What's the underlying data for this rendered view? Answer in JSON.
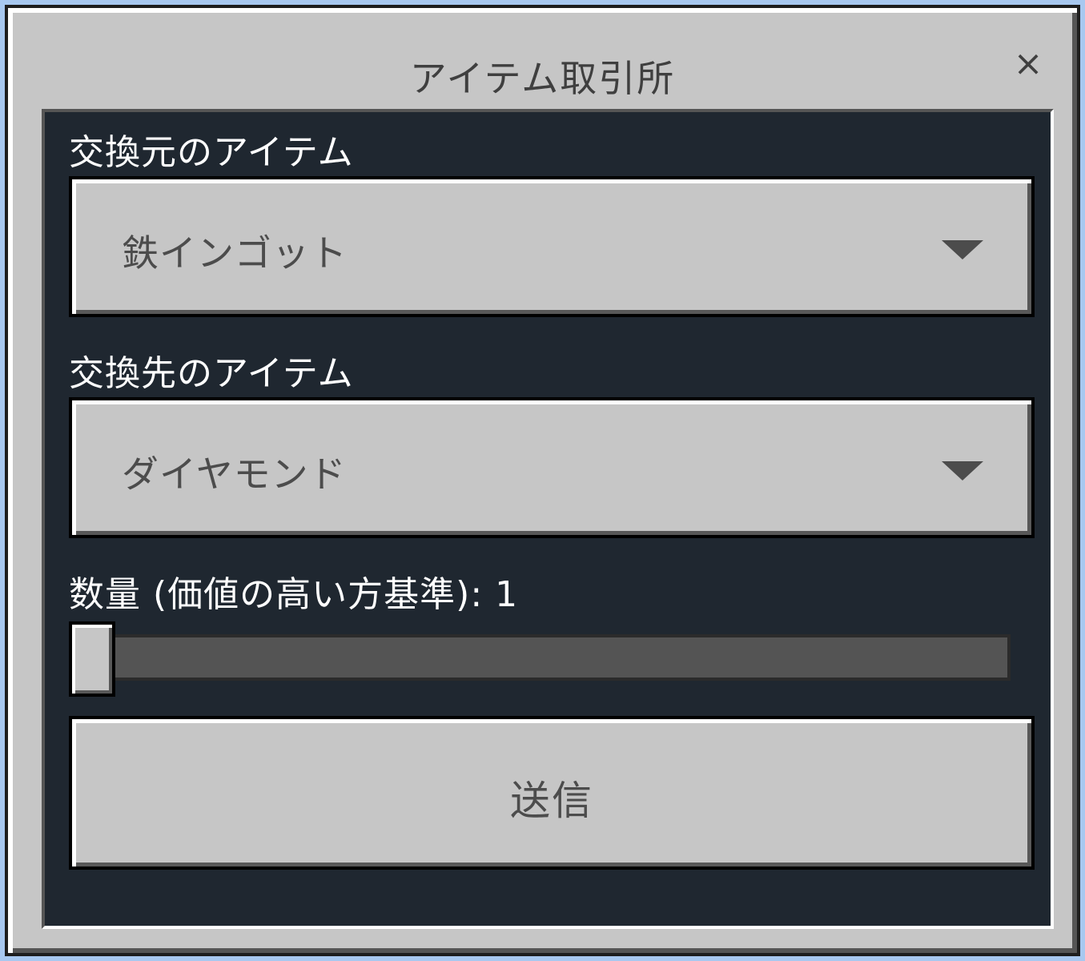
{
  "window": {
    "title": "アイテム取引所",
    "close_glyph": "×"
  },
  "form": {
    "source": {
      "label": "交換元のアイテム",
      "selected": "鉄インゴット"
    },
    "target": {
      "label": "交換先のアイテム",
      "selected": "ダイヤモンド"
    },
    "quantity": {
      "label": "数量 (価値の高い方基準): 1",
      "value": 1,
      "fraction": 0
    },
    "submit_label": "送信"
  },
  "icons": {
    "close": "close-icon",
    "dropdown": "triangle-down-icon"
  },
  "colors": {
    "window_bg": "#c6c6c6",
    "panel_bg": "#1f2730",
    "label_text": "#ffffff",
    "button_text": "#4c4c4c",
    "slider_track": "#545454"
  }
}
